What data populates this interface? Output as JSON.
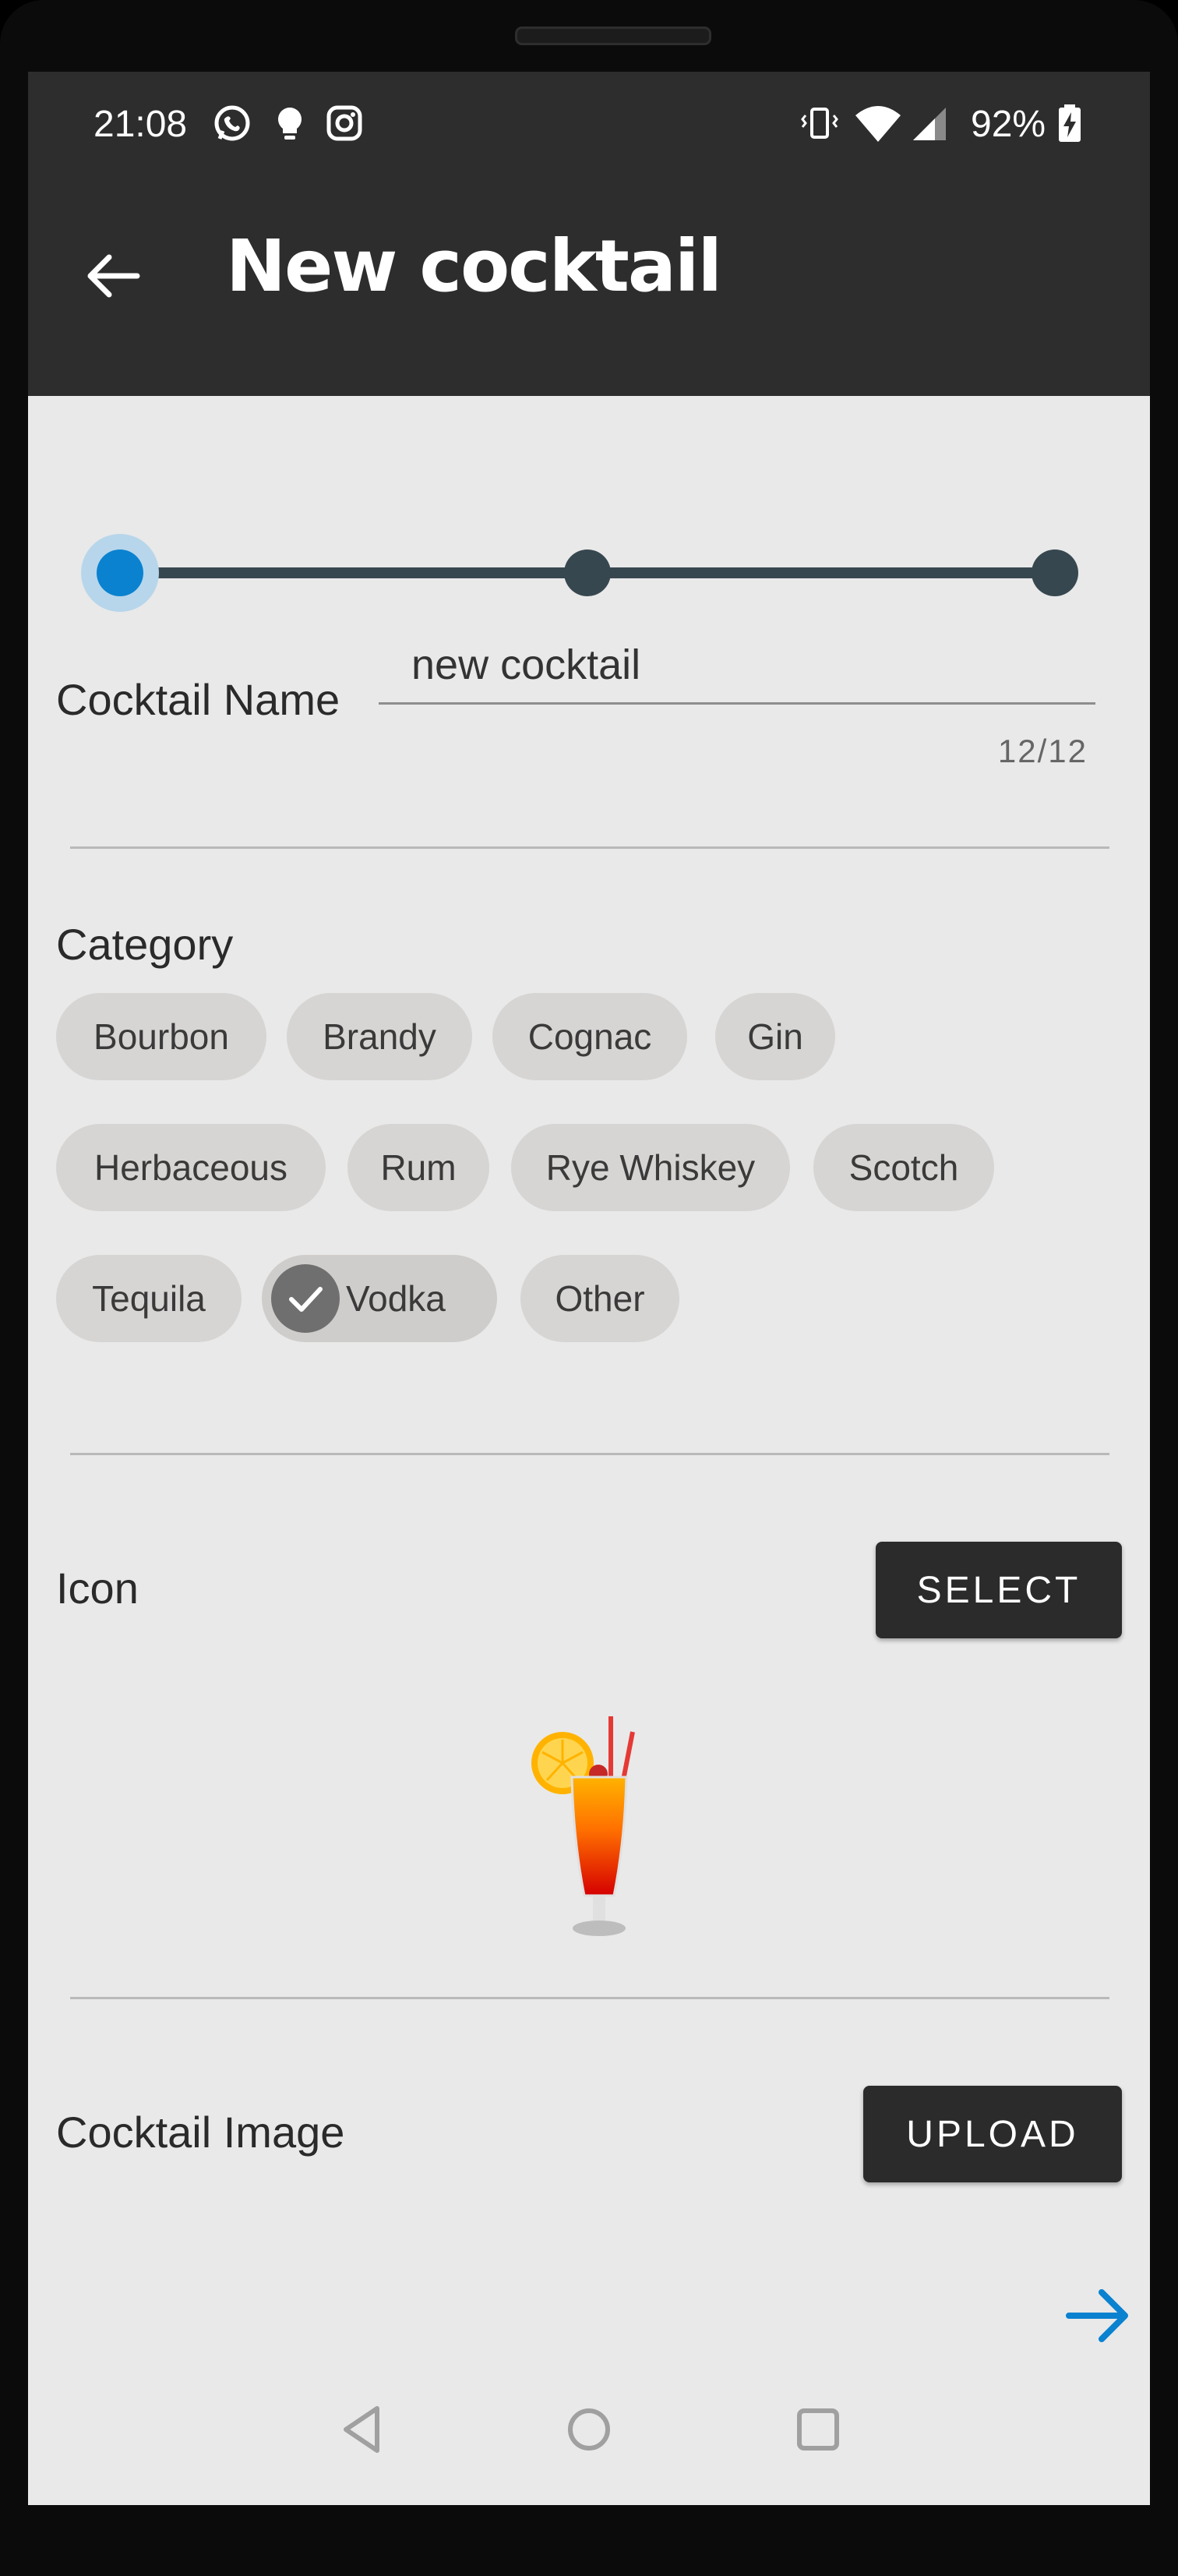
{
  "status_bar": {
    "time": "21:08",
    "battery": "92%"
  },
  "app_bar": {
    "title": "New cocktail",
    "back_icon": "arrow-back-icon"
  },
  "stepper": {
    "steps": 3,
    "current_step": 1
  },
  "cocktail_name": {
    "label": "Cocktail Name",
    "value": "new cocktail",
    "counter": "12/12"
  },
  "category": {
    "label": "Category",
    "chips": [
      "Bourbon",
      "Brandy",
      "Cognac",
      "Gin",
      "Herbaceous",
      "Rum",
      "Rye Whiskey",
      "Scotch",
      "Tequila",
      "Vodka",
      "Other"
    ],
    "selected": "Vodka"
  },
  "icon_section": {
    "label": "Icon",
    "select_label": "SELECT",
    "icon": "cocktail-glass-icon"
  },
  "image_section": {
    "label": "Cocktail Image",
    "upload_label": "UPLOAD"
  },
  "next_icon": "arrow-forward-icon",
  "colors": {
    "accent": "#0a82d0",
    "app_bar": "#2d2d2d",
    "background": "#e9e9e9",
    "chip": "#d7d5d3"
  }
}
